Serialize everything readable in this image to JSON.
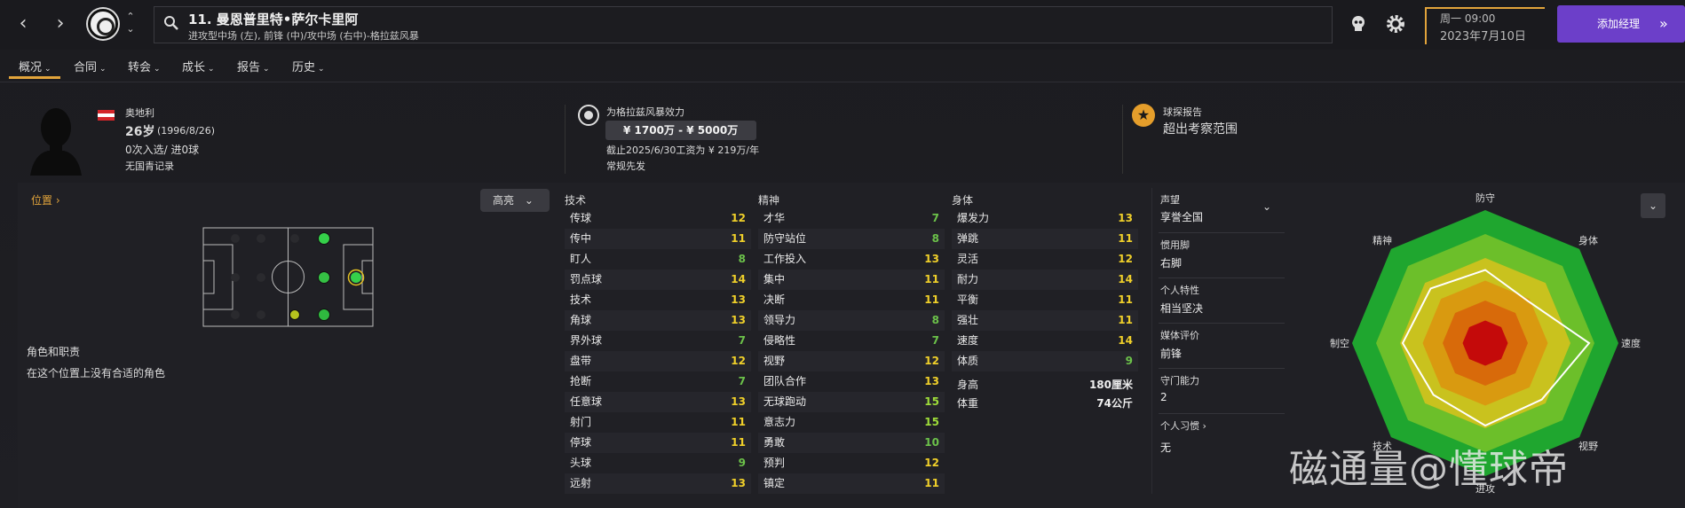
{
  "header": {
    "player_title": "11. 曼恩普里特•萨尔卡里阿",
    "player_subtitle": "进攻型中场 (左), 前锋 (中)/攻中场 (右中)-格拉兹风暴",
    "date_weekday": "周一 09:00",
    "date": "2023年7月10日",
    "add_manager": "添加经理"
  },
  "tabs": [
    {
      "label": "概况"
    },
    {
      "label": "合同"
    },
    {
      "label": "转会"
    },
    {
      "label": "成长"
    },
    {
      "label": "报告"
    },
    {
      "label": "历史"
    }
  ],
  "info": {
    "nationality": "奥地利",
    "age": "26岁",
    "dob": "(1996/8/26)",
    "caps": "0次入选/ 进0球",
    "youth": "无国青记录",
    "club_label": "为格拉兹风暴效力",
    "value": "¥ 1700万 - ¥ 5000万",
    "contract": "截止2025/6/30工资为 ¥ 219万/年",
    "status": "常规先发",
    "scout_label": "球探报告",
    "scout_value": "超出考察范围"
  },
  "position": {
    "link": "位置",
    "highlight": "高亮",
    "role_title": "角色和职责",
    "role_text": "在这个位置上没有合适的角色"
  },
  "attributes": {
    "technical": {
      "title": "技术",
      "items": [
        {
          "name": "传球",
          "value": "12"
        },
        {
          "name": "传中",
          "value": "11"
        },
        {
          "name": "盯人",
          "value": "8"
        },
        {
          "name": "罚点球",
          "value": "14"
        },
        {
          "name": "技术",
          "value": "13"
        },
        {
          "name": "角球",
          "value": "13"
        },
        {
          "name": "界外球",
          "value": "7"
        },
        {
          "name": "盘带",
          "value": "12"
        },
        {
          "name": "抢断",
          "value": "7"
        },
        {
          "name": "任意球",
          "value": "13"
        },
        {
          "name": "射门",
          "value": "11"
        },
        {
          "name": "停球",
          "value": "11"
        },
        {
          "name": "头球",
          "value": "9"
        },
        {
          "name": "远射",
          "value": "13"
        }
      ]
    },
    "mental": {
      "title": "精神",
      "items": [
        {
          "name": "才华",
          "value": "7"
        },
        {
          "name": "防守站位",
          "value": "8"
        },
        {
          "name": "工作投入",
          "value": "13"
        },
        {
          "name": "集中",
          "value": "11"
        },
        {
          "name": "决断",
          "value": "11"
        },
        {
          "name": "领导力",
          "value": "8"
        },
        {
          "name": "侵略性",
          "value": "7"
        },
        {
          "name": "视野",
          "value": "12"
        },
        {
          "name": "团队合作",
          "value": "13"
        },
        {
          "name": "无球跑动",
          "value": "15"
        },
        {
          "name": "意志力",
          "value": "15"
        },
        {
          "name": "勇敢",
          "value": "10"
        },
        {
          "name": "预判",
          "value": "12"
        },
        {
          "name": "镇定",
          "value": "11"
        }
      ]
    },
    "physical": {
      "title": "身体",
      "items": [
        {
          "name": "爆发力",
          "value": "13"
        },
        {
          "name": "弹跳",
          "value": "11"
        },
        {
          "name": "灵活",
          "value": "12"
        },
        {
          "name": "耐力",
          "value": "14"
        },
        {
          "name": "平衡",
          "value": "11"
        },
        {
          "name": "强壮",
          "value": "11"
        },
        {
          "name": "速度",
          "value": "14"
        },
        {
          "name": "体质",
          "value": "9"
        }
      ],
      "height_label": "身高",
      "height_value": "180厘米",
      "weight_label": "体重",
      "weight_value": "74公斤"
    }
  },
  "side": [
    {
      "label": "声望",
      "value": "享誉全国"
    },
    {
      "label": "惯用脚",
      "value": "右脚"
    },
    {
      "label": "个人特性",
      "value": "相当坚决"
    },
    {
      "label": "媒体评价",
      "value": "前锋"
    },
    {
      "label": "守门能力",
      "value": "2"
    },
    {
      "label": "个人习惯",
      "value": "无"
    }
  ],
  "radar": {
    "labels": [
      "防守",
      "身体",
      "速度",
      "视野",
      "进攻",
      "技术",
      "制空",
      "精神"
    ],
    "values": [
      0.55,
      0.45,
      0.78,
      0.6,
      0.62,
      0.55,
      0.62,
      0.58
    ],
    "colors": [
      "#1fa62f",
      "#6cbf2a",
      "#c9c21e",
      "#d99a10",
      "#d86a0a",
      "#c40a0a"
    ]
  },
  "colors": {
    "accent": "#e2a43b",
    "value_high": "#f0d02a",
    "value_mid": "#6cc24a",
    "value_top": "#9fdd3a",
    "purple_button": "#6c3fc9"
  },
  "watermark": "磁通量@懂球帝"
}
